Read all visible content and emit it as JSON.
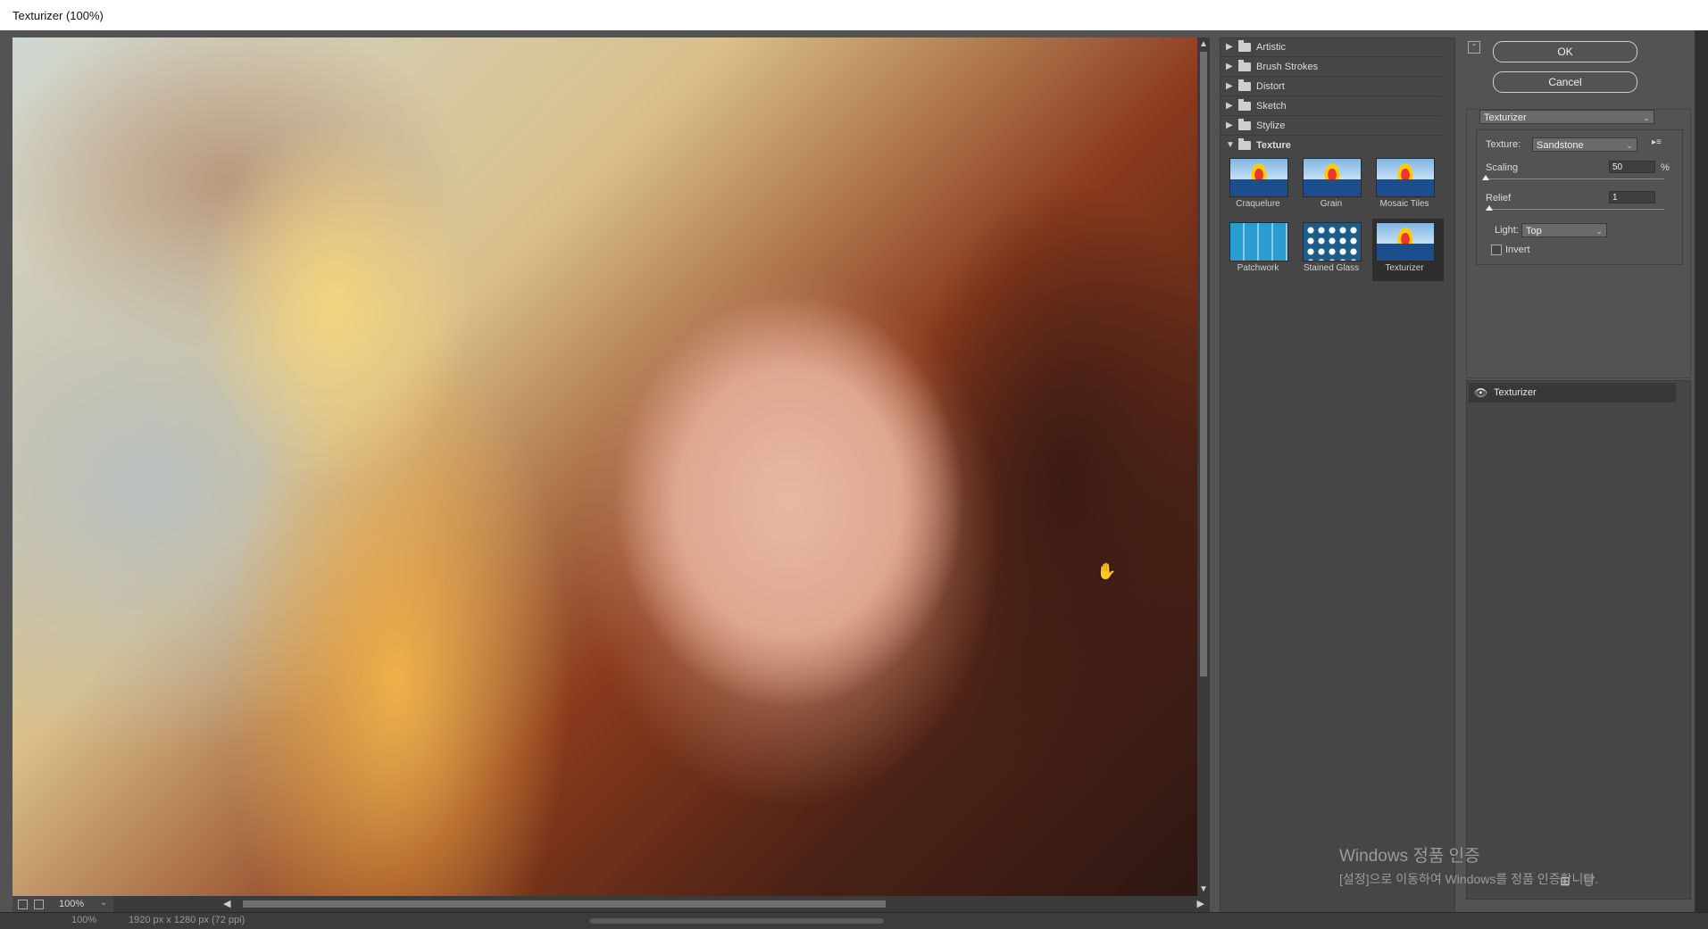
{
  "window": {
    "title": "Texturizer (100%)"
  },
  "preview": {
    "zoom_label": "100%"
  },
  "status_strip": {
    "zoom": "100%",
    "doc_size": "1920 px x 1280 px (72 ppi)"
  },
  "gallery": {
    "categories": [
      {
        "label": "Artistic",
        "expanded": false
      },
      {
        "label": "Brush Strokes",
        "expanded": false
      },
      {
        "label": "Distort",
        "expanded": false
      },
      {
        "label": "Sketch",
        "expanded": false
      },
      {
        "label": "Stylize",
        "expanded": false
      },
      {
        "label": "Texture",
        "expanded": true
      }
    ],
    "texture_filters": [
      "Craquelure",
      "Grain",
      "Mosaic Tiles",
      "Patchwork",
      "Stained Glass",
      "Texturizer"
    ],
    "selected": "Texturizer"
  },
  "settings": {
    "ok_label": "OK",
    "cancel_label": "Cancel",
    "filter_select": "Texturizer",
    "texture_label": "Texture:",
    "texture_value": "Sandstone",
    "scaling_label": "Scaling",
    "scaling_value": "50",
    "scaling_unit": "%",
    "scaling_fraction": 0.0,
    "relief_label": "Relief",
    "relief_value": "1",
    "relief_fraction": 0.02,
    "light_label": "Light:",
    "light_value": "Top",
    "invert_label": "Invert",
    "invert_checked": false
  },
  "layers": [
    {
      "label": "Texturizer",
      "visible": true
    }
  ],
  "watermark": {
    "line1": "Windows 정품 인증",
    "line2": "[설정]으로 이동하여 Windows를 정품 인증합니다."
  }
}
